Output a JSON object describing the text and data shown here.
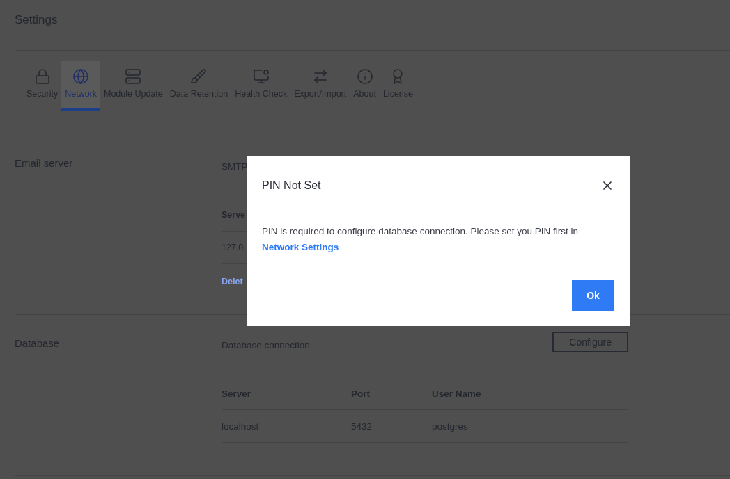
{
  "page": {
    "title": "Settings"
  },
  "tabs": [
    {
      "label": "Security",
      "selected": false
    },
    {
      "label": "Network",
      "selected": true
    },
    {
      "label": "Module Update",
      "selected": false
    },
    {
      "label": "Data Retention",
      "selected": false
    },
    {
      "label": "Health Check",
      "selected": false
    },
    {
      "label": "Export/Import",
      "selected": false
    },
    {
      "label": "About",
      "selected": false
    },
    {
      "label": "License",
      "selected": false
    }
  ],
  "email_server": {
    "heading": "Email server",
    "subheading": "SMTP",
    "column_1": "Serve",
    "row_1": "127.0.",
    "link": "Delet"
  },
  "database": {
    "heading": "Database",
    "subheading": "Database connection",
    "button": "Configure",
    "columns": [
      "Server",
      "Port",
      "User Name"
    ],
    "rows": [
      [
        "localhost",
        "5432",
        "postgres"
      ]
    ]
  },
  "dialog": {
    "title": "PIN Not Set",
    "message": "PIN is required to configure database connection. Please set you PIN first in",
    "link": "Network Settings",
    "button": "Ok"
  }
}
